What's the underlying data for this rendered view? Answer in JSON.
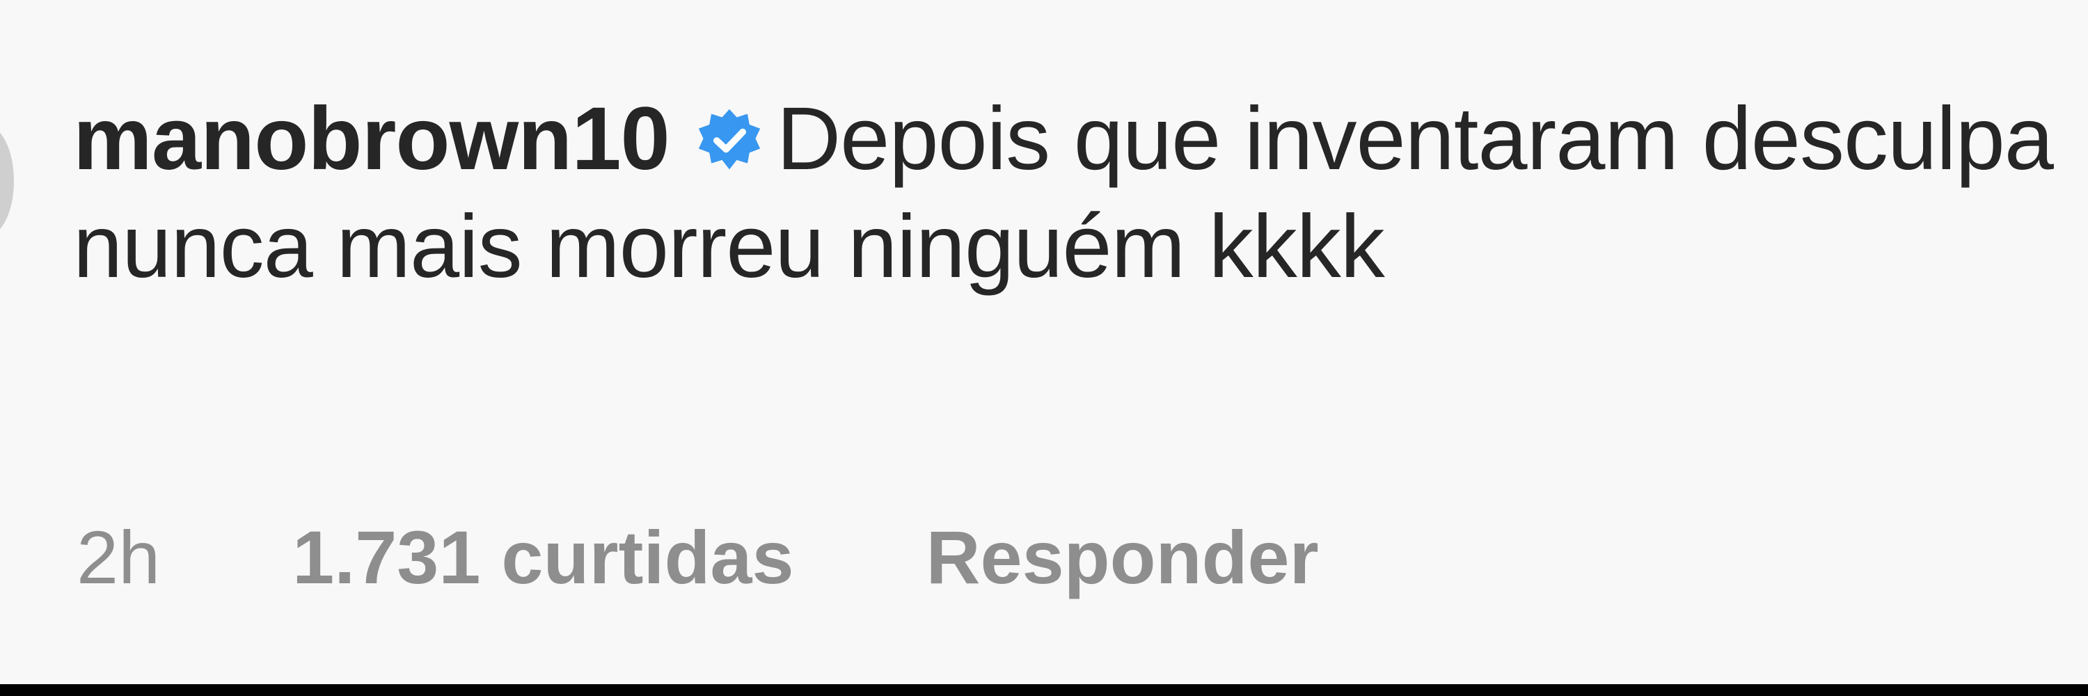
{
  "comment": {
    "username": "manobrown10",
    "verified_icon": "verified-badge-icon",
    "text": "Depois que inventaram desculpa nunca mais morreu ninguém kkkk",
    "timestamp": "2h",
    "likes": "1.731 curtidas",
    "reply_label": "Responder"
  },
  "colors": {
    "background": "#f8f8f8",
    "text": "#262626",
    "meta_text": "#8e8e8e",
    "verified_badge": "#3897f0",
    "bottom_bar": "#000000"
  }
}
